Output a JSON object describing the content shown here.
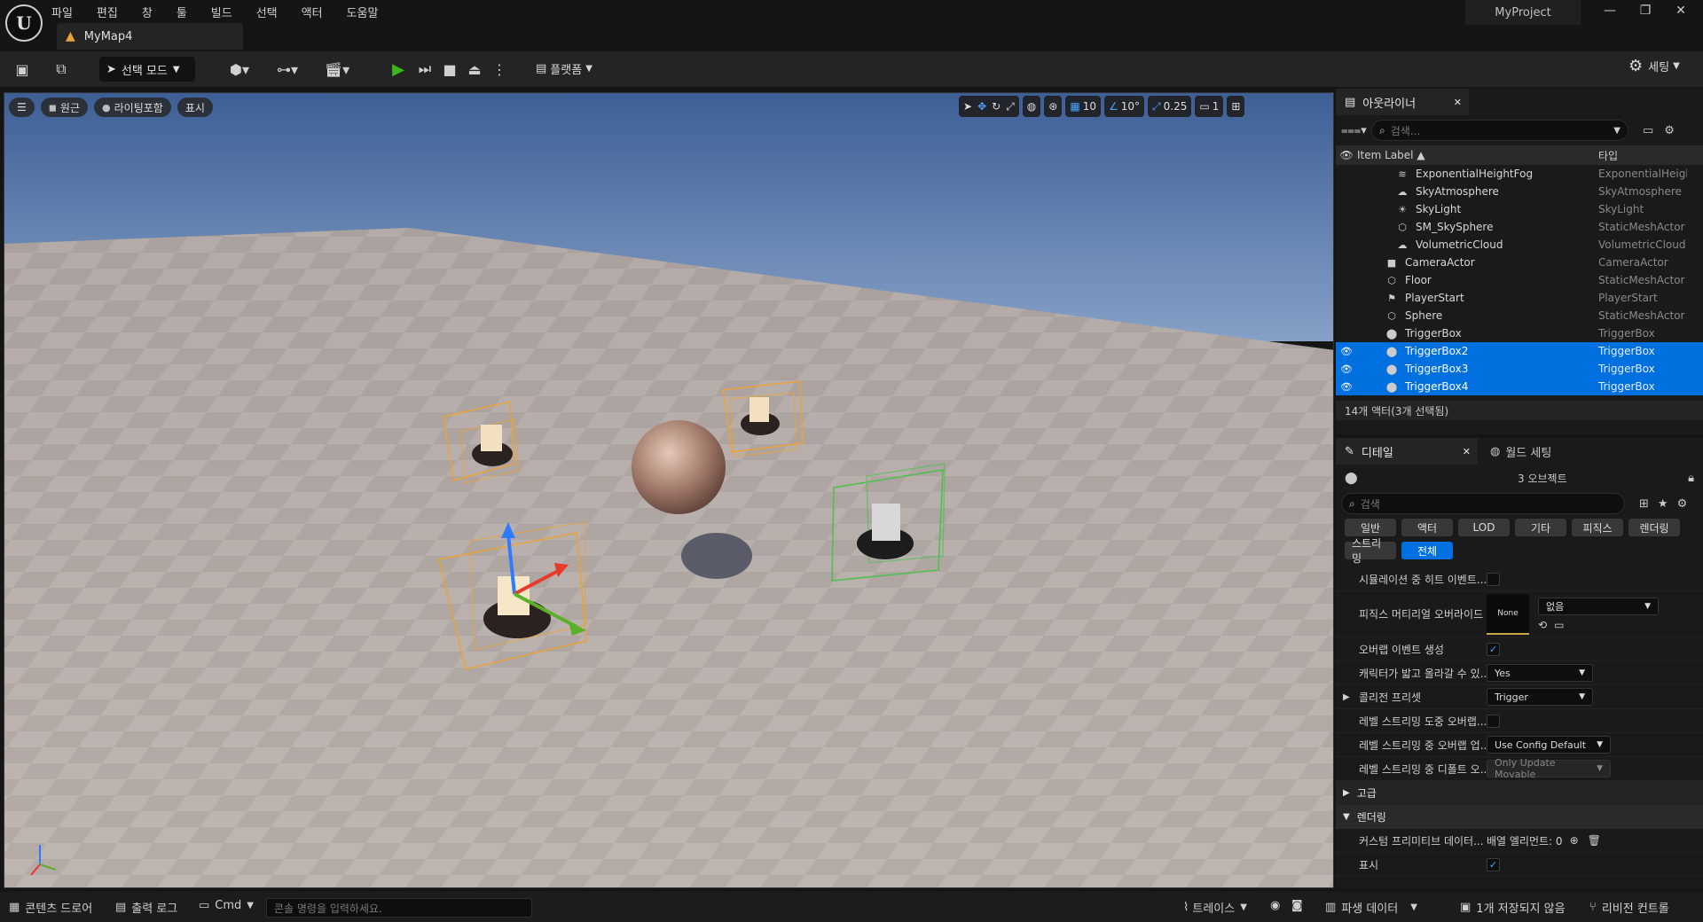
{
  "menu": [
    "파일",
    "편집",
    "창",
    "툴",
    "빌드",
    "선택",
    "액터",
    "도움말"
  ],
  "map_tab": "MyMap4",
  "project_name": "MyProject",
  "toolbar": {
    "mode_label": "선택 모드",
    "platform_label": "플랫폼",
    "settings_label": "세팅"
  },
  "viewport": {
    "perspective_label": "원근",
    "lighting_label": "라이팅포함",
    "show_label": "표시",
    "grid_snap": "10",
    "rotation_snap": "10°",
    "scale_snap": "0.25",
    "camera_speed": "1"
  },
  "outliner": {
    "tab_label": "아웃라이너",
    "search_placeholder": "검색...",
    "col_label": "Item Label ▲",
    "col_type": "타입",
    "rows": [
      {
        "label": "ExponentialHeightFog",
        "type": "ExponentialHeigh",
        "icon": "fog-icon",
        "indent": 2,
        "selected": false
      },
      {
        "label": "SkyAtmosphere",
        "type": "SkyAtmosphere",
        "icon": "sky-icon",
        "indent": 2,
        "selected": false
      },
      {
        "label": "SkyLight",
        "type": "SkyLight",
        "icon": "skylight-icon",
        "indent": 2,
        "selected": false
      },
      {
        "label": "SM_SkySphere",
        "type": "StaticMeshActor",
        "icon": "mesh-icon",
        "indent": 2,
        "selected": false
      },
      {
        "label": "VolumetricCloud",
        "type": "VolumetricCloud",
        "icon": "cloud-icon",
        "indent": 2,
        "selected": false
      },
      {
        "label": "CameraActor",
        "type": "CameraActor",
        "icon": "camera-icon",
        "indent": 1,
        "selected": false
      },
      {
        "label": "Floor",
        "type": "StaticMeshActor",
        "icon": "mesh-icon",
        "indent": 1,
        "selected": false
      },
      {
        "label": "PlayerStart",
        "type": "PlayerStart",
        "icon": "player-start-icon",
        "indent": 1,
        "selected": false
      },
      {
        "label": "Sphere",
        "type": "StaticMeshActor",
        "icon": "mesh-icon",
        "indent": 1,
        "selected": false
      },
      {
        "label": "TriggerBox",
        "type": "TriggerBox",
        "icon": "trigger-icon",
        "indent": 1,
        "selected": false
      },
      {
        "label": "TriggerBox2",
        "type": "TriggerBox",
        "icon": "trigger-icon",
        "indent": 1,
        "selected": true
      },
      {
        "label": "TriggerBox3",
        "type": "TriggerBox",
        "icon": "trigger-icon",
        "indent": 1,
        "selected": true
      },
      {
        "label": "TriggerBox4",
        "type": "TriggerBox",
        "icon": "trigger-icon",
        "indent": 1,
        "selected": true
      }
    ],
    "footer": "14개 액터(3개 선택됨)"
  },
  "details": {
    "tab_label": "디테일",
    "world_tab_label": "월드 세팅",
    "object_count": "3 오브젝트",
    "search_placeholder": "검색",
    "chips_row1": [
      "일반",
      "액터",
      "LOD",
      "기타",
      "피직스",
      "렌더링"
    ],
    "chips_row2": [
      "스트리밍",
      "전체"
    ],
    "active_chip": "전체",
    "props": [
      {
        "label": "시뮬레이션 중 히트 이벤트...",
        "kind": "checkbox",
        "checked": false
      },
      {
        "label": "피직스 머티리얼 오버라이드",
        "kind": "material",
        "thumb": "None",
        "value": "없음"
      },
      {
        "label": "오버랩 이벤트 생성",
        "kind": "checkbox",
        "checked": true
      },
      {
        "label": "캐릭터가 밟고 올라갈 수 있...",
        "kind": "dropdown",
        "value": "Yes"
      },
      {
        "label": "콜리전 프리셋",
        "kind": "dropdown",
        "value": "Trigger",
        "expandable": true
      },
      {
        "label": "레벨 스트리밍 도중 오버랩...",
        "kind": "checkbox",
        "checked": false
      },
      {
        "label": "레벨 스트리밍 중 오버랩 업...",
        "kind": "dropdown",
        "value": "Use Config Default"
      },
      {
        "label": "레벨 스트리밍 중 디폴트 오...",
        "kind": "dropdown",
        "value": "Only Update Movable",
        "disabled": true
      }
    ],
    "section_advanced": "고급",
    "section_rendering": "렌더링",
    "custom_primitive_label": "커스텀 프리미티브 데이터...",
    "custom_primitive_value": "배열 엘리먼트: 0",
    "visible_label": "표시"
  },
  "statusbar": {
    "content_drawer": "콘텐츠 드로어",
    "output_log": "출력 로그",
    "cmd": "Cmd",
    "cmd_placeholder": "콘솔 명령을 입력하세요.",
    "trace": "트레이스",
    "derived_data": "파생 데이터",
    "unsaved": "1개 저장되지 않음",
    "revision_control": "리비전 컨트롤"
  },
  "colors": {
    "selection": "#0070e0",
    "accent_blue": "#4aa3ff",
    "play_green": "#3fb618",
    "warning": "#e8a33a"
  }
}
